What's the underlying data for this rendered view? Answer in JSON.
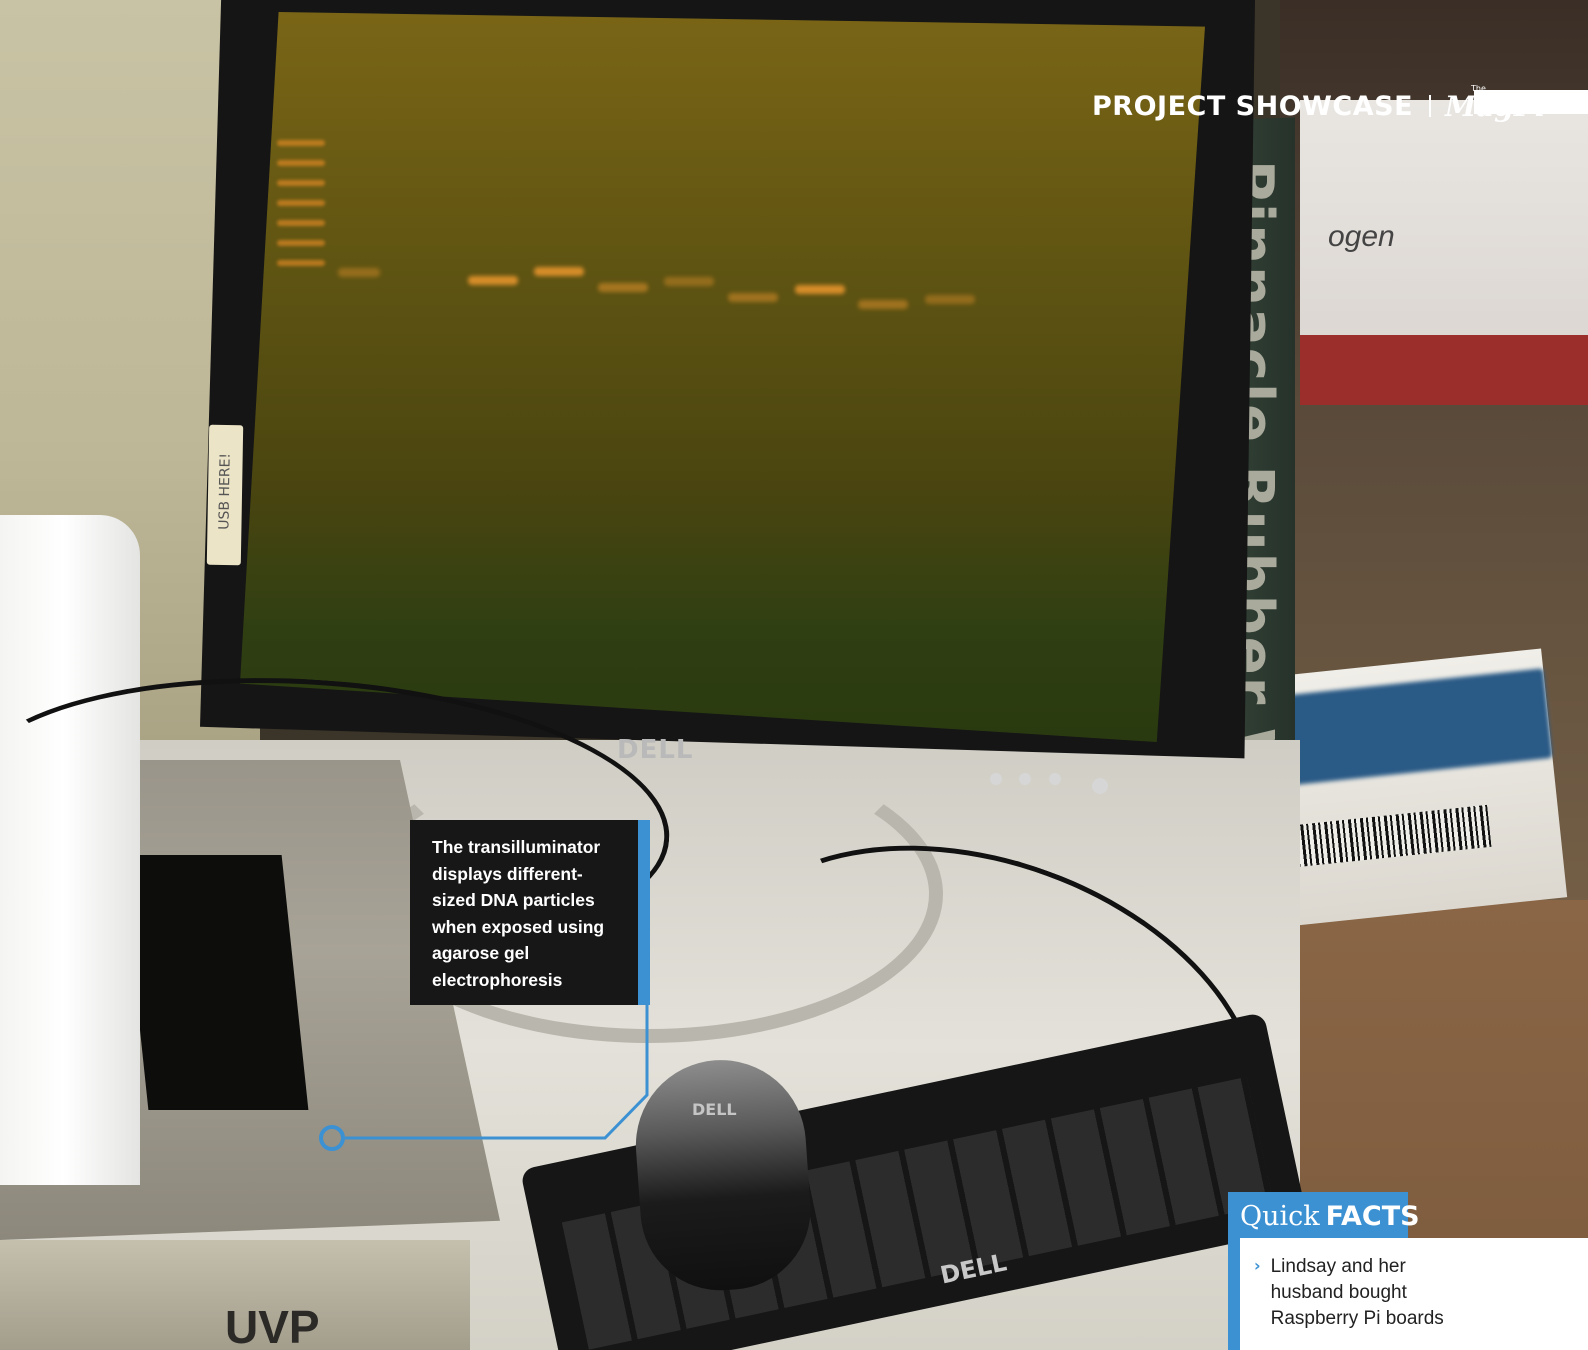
{
  "header": {
    "section_title": "PROJECT SHOWCASE",
    "logo_small": "The",
    "logo_text": "MagPi"
  },
  "photo": {
    "usb_label": "USB HERE!",
    "monitor_brand": "DELL",
    "mouse_brand": "DELL",
    "keyboard_brand": "DELL",
    "wall_base_text": "Pinnacle Rubber Wall Base",
    "box_brand_fragment": "ogen",
    "device_label_fragment": "UVP"
  },
  "caption": {
    "text": "The transilluminator displays different-sized DNA particles when exposed using agarose gel electrophoresis"
  },
  "quick_facts": {
    "title_light": "Quick",
    "title_bold": "FACTS",
    "items": [
      "Lindsay and her husband bought Raspberry Pi boards"
    ]
  },
  "colors": {
    "accent": "#3c91d3",
    "caption_bg": "#171717",
    "header_text": "#ffffff"
  }
}
